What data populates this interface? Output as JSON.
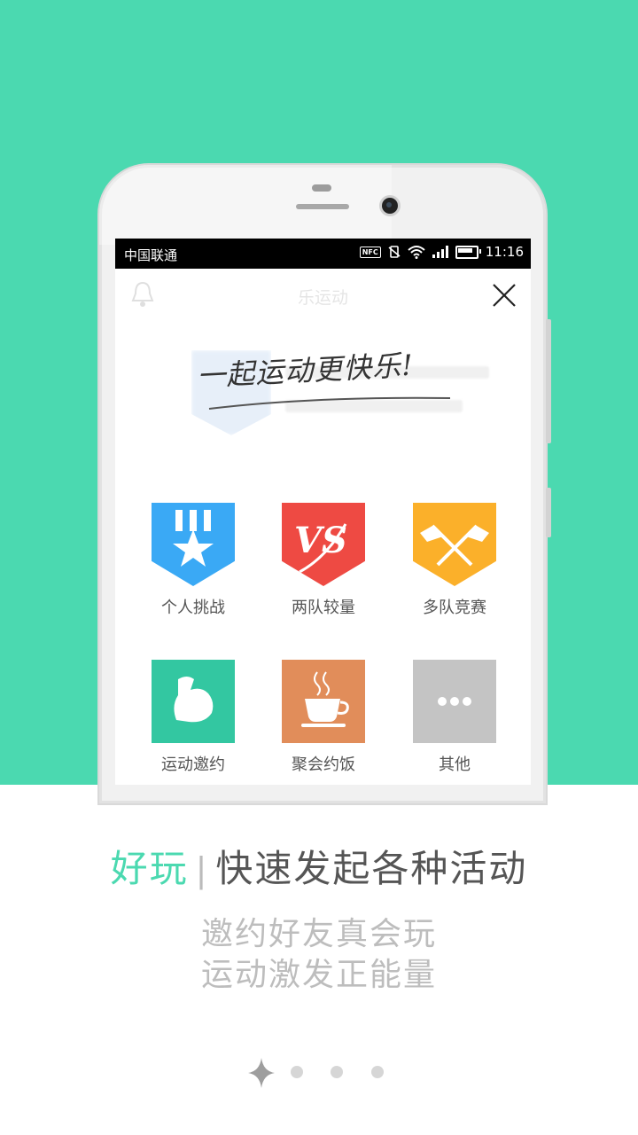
{
  "status_bar": {
    "carrier": "中国联通",
    "nfc": "NFC",
    "time": "11:16"
  },
  "app_header": {
    "title": "乐运动"
  },
  "banner": {
    "slogan": "一起运动更快乐!"
  },
  "activities": [
    {
      "label": "个人挑战",
      "icon": "medal-star-icon",
      "color": "#3aa9f5"
    },
    {
      "label": "两队较量",
      "icon": "versus-icon",
      "color": "#ee4a43"
    },
    {
      "label": "多队竞赛",
      "icon": "crossed-flags-icon",
      "color": "#fbb02a"
    },
    {
      "label": "运动邀约",
      "icon": "flexed-arm-icon",
      "color": "#33c7a1"
    },
    {
      "label": "聚会约饭",
      "icon": "coffee-cup-icon",
      "color": "#e18d5a"
    },
    {
      "label": "其他",
      "icon": "more-dots-icon",
      "color": "#c4c4c4"
    }
  ],
  "onboarding": {
    "accent": "好玩",
    "separator": "|",
    "title": "快速发起各种活动",
    "line1": "邀约好友真会玩",
    "line2": "运动激发正能量"
  },
  "pager": {
    "current": 1,
    "total": 4
  },
  "colors": {
    "brand": "#4bd9b0"
  }
}
